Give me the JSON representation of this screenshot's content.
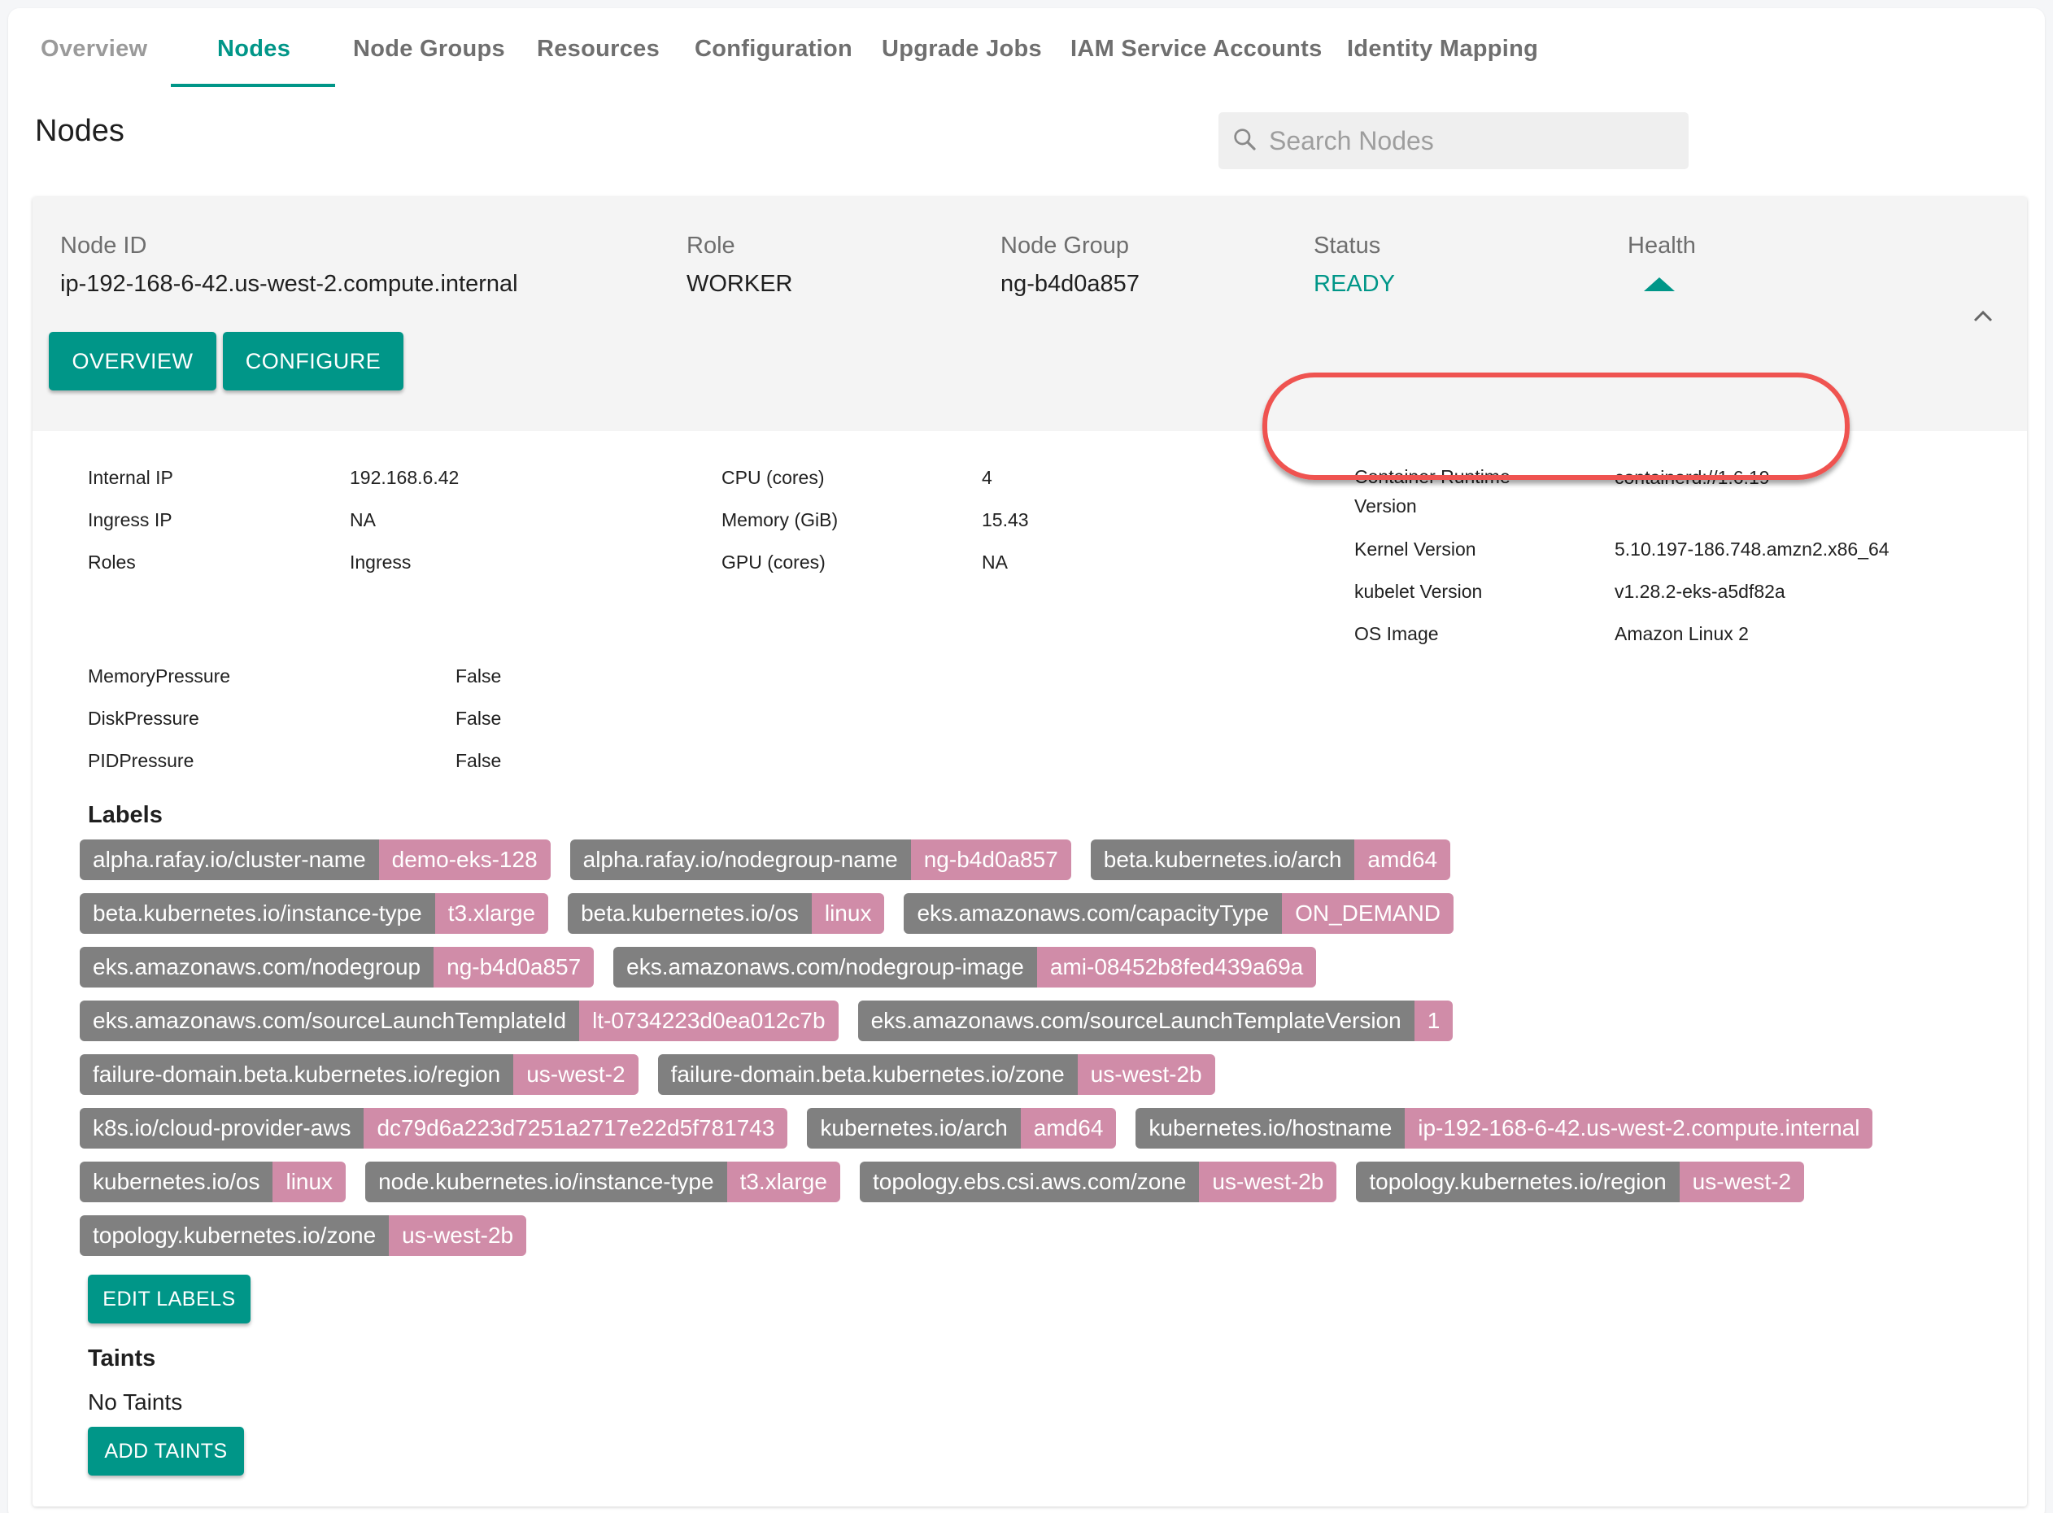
{
  "tabs": [
    {
      "label": "Overview",
      "state": "dim"
    },
    {
      "label": "Nodes",
      "state": "active"
    },
    {
      "label": "Node Groups",
      "state": "normal"
    },
    {
      "label": "Resources",
      "state": "normal"
    },
    {
      "label": "Configuration",
      "state": "normal"
    },
    {
      "label": "Upgrade Jobs",
      "state": "normal"
    },
    {
      "label": "IAM Service Accounts",
      "state": "normal"
    },
    {
      "label": "Identity Mapping",
      "state": "normal"
    }
  ],
  "page_title": "Nodes",
  "search": {
    "placeholder": "Search Nodes",
    "value": "",
    "icon": "search-icon"
  },
  "node": {
    "header": {
      "node_id_label": "Node ID",
      "node_id": "ip-192-168-6-42.us-west-2.compute.internal",
      "role_label": "Role",
      "role": "WORKER",
      "node_group_label": "Node Group",
      "node_group": "ng-b4d0a857",
      "status_label": "Status",
      "status": "READY",
      "health_label": "Health",
      "health_icon": "triangle-up-icon",
      "collapse_icon": "chevron-up-icon"
    },
    "buttons": {
      "overview": "OVERVIEW",
      "configure": "CONFIGURE"
    },
    "details_left": [
      {
        "label": "Internal IP",
        "value": "192.168.6.42"
      },
      {
        "label": "Ingress IP",
        "value": "NA"
      },
      {
        "label": "Roles",
        "value": "Ingress"
      }
    ],
    "details_mid": [
      {
        "label": "CPU (cores)",
        "value": "4"
      },
      {
        "label": "Memory (GiB)",
        "value": "15.43"
      },
      {
        "label": "GPU (cores)",
        "value": "NA"
      }
    ],
    "details_right": [
      {
        "label": "Container Runtime Version",
        "value": "containerd://1.6.19"
      },
      {
        "label": "Kernel Version",
        "value": "5.10.197-186.748.amzn2.x86_64"
      },
      {
        "label": "kubelet Version",
        "value": "v1.28.2-eks-a5df82a"
      },
      {
        "label": "OS Image",
        "value": "Amazon Linux 2"
      }
    ],
    "conditions": [
      {
        "label": "MemoryPressure",
        "value": "False"
      },
      {
        "label": "DiskPressure",
        "value": "False"
      },
      {
        "label": "PIDPressure",
        "value": "False"
      }
    ],
    "labels_title": "Labels",
    "label_rows": [
      [
        {
          "key": "alpha.rafay.io/cluster-name",
          "value": "demo-eks-128"
        },
        {
          "key": "alpha.rafay.io/nodegroup-name",
          "value": "ng-b4d0a857"
        },
        {
          "key": "beta.kubernetes.io/arch",
          "value": "amd64"
        }
      ],
      [
        {
          "key": "beta.kubernetes.io/instance-type",
          "value": "t3.xlarge"
        },
        {
          "key": "beta.kubernetes.io/os",
          "value": "linux"
        },
        {
          "key": "eks.amazonaws.com/capacityType",
          "value": "ON_DEMAND"
        }
      ],
      [
        {
          "key": "eks.amazonaws.com/nodegroup",
          "value": "ng-b4d0a857"
        },
        {
          "key": "eks.amazonaws.com/nodegroup-image",
          "value": "ami-08452b8fed439a69a"
        }
      ],
      [
        {
          "key": "eks.amazonaws.com/sourceLaunchTemplateId",
          "value": "lt-0734223d0ea012c7b"
        },
        {
          "key": "eks.amazonaws.com/sourceLaunchTemplateVersion",
          "value": "1"
        }
      ],
      [
        {
          "key": "failure-domain.beta.kubernetes.io/region",
          "value": "us-west-2"
        },
        {
          "key": "failure-domain.beta.kubernetes.io/zone",
          "value": "us-west-2b"
        }
      ],
      [
        {
          "key": "k8s.io/cloud-provider-aws",
          "value": "dc79d6a223d7251a2717e22d5f781743"
        },
        {
          "key": "kubernetes.io/arch",
          "value": "amd64"
        },
        {
          "key": "kubernetes.io/hostname",
          "value": "ip-192-168-6-42.us-west-2.compute.internal"
        }
      ],
      [
        {
          "key": "kubernetes.io/os",
          "value": "linux"
        },
        {
          "key": "node.kubernetes.io/instance-type",
          "value": "t3.xlarge"
        },
        {
          "key": "topology.ebs.csi.aws.com/zone",
          "value": "us-west-2b"
        },
        {
          "key": "topology.kubernetes.io/region",
          "value": "us-west-2"
        }
      ],
      [
        {
          "key": "topology.kubernetes.io/zone",
          "value": "us-west-2b"
        }
      ]
    ],
    "edit_labels": "EDIT LABELS",
    "taints_title": "Taints",
    "no_taints": "No Taints",
    "add_taints": "ADD TAINTS"
  },
  "colors": {
    "accent": "#009688",
    "label_key_bg": "#808080",
    "label_value_bg": "#d08ca8",
    "annotation": "#ef5350"
  }
}
